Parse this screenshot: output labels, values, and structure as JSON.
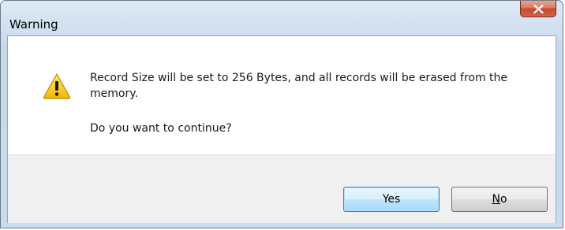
{
  "window": {
    "title": "Warning"
  },
  "dialog": {
    "message": "Record Size will be set to 256 Bytes, and all records will be erased from the memory.",
    "question": "Do you want to continue?",
    "icon": "warning-icon"
  },
  "buttons": {
    "yes_label": "Yes",
    "no_label_mnemonic": "N",
    "no_label_rest": "o"
  },
  "colors": {
    "close_button": "#c74a2c",
    "default_button_border": "#3c7fb1",
    "warning_yellow": "#f5c400"
  }
}
